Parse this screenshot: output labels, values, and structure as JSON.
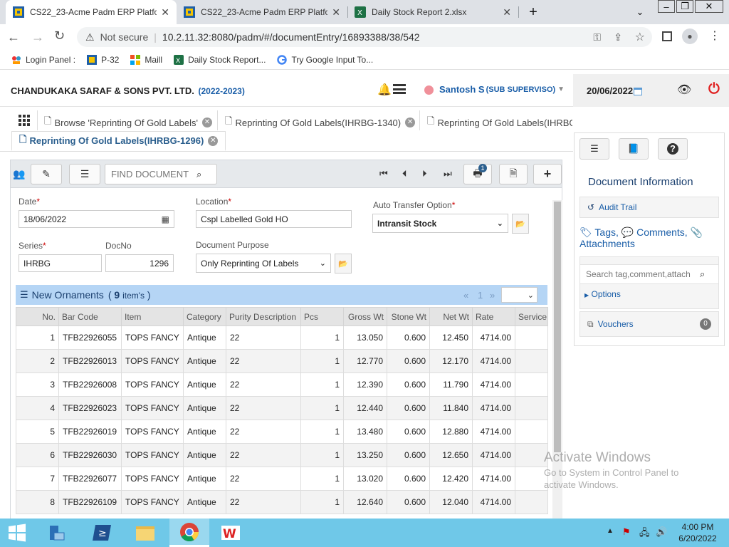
{
  "browser": {
    "tabs": [
      {
        "title": "CS22_23-Acme Padm ERP Platfor",
        "active": true
      },
      {
        "title": "CS22_23-Acme Padm ERP Platfor",
        "active": false
      },
      {
        "title": "Daily Stock Report 2.xlsx",
        "active": false
      }
    ],
    "security": "Not secure",
    "url": "10.2.11.32:8080/padm/#/documentEntry/16893388/38/542",
    "bookmarks": [
      "Login Panel :",
      "P-32",
      "Maill",
      "Daily Stock Report...",
      "Try Google Input To..."
    ]
  },
  "header": {
    "company": "CHANDUKAKA SARAF & SONS PVT. LTD.",
    "fy": "(2022-2023)",
    "user": "Santosh S",
    "role": "(SUB SUPERVISO)",
    "date": "20/06/2022"
  },
  "doc_tabs": [
    {
      "label": "Browse 'Reprinting Of Gold Labels'"
    },
    {
      "label": "Reprinting Of Gold Labels(IHRBG-1340)"
    },
    {
      "label": "Reprinting Of Gold Labels(IHRBG"
    },
    {
      "label": "Reprinting Of Gold Labels(IHRBG-1296)"
    }
  ],
  "toolbar": {
    "find_placeholder": "FIND DOCUMENT",
    "badge": "1"
  },
  "form": {
    "date_label": "Date",
    "date_value": "18/06/2022",
    "location_label": "Location",
    "location_value": "Cspl Labelled Gold HO",
    "auto_transfer_label": "Auto Transfer Option",
    "auto_transfer_value": "Intransit Stock",
    "series_label": "Series",
    "series_value": "IHRBG",
    "docno_label": "DocNo",
    "docno_value": "1296",
    "purpose_label": "Document Purpose",
    "purpose_value": "Only Reprinting Of Labels"
  },
  "grid": {
    "title": "New Ornaments",
    "count": "9",
    "count_suffix": "item's",
    "pager": {
      "prev": "«",
      "page": "1",
      "next": "»"
    },
    "columns": [
      "No.",
      "Bar Code",
      "Item",
      "Category",
      "Purity Description",
      "Pcs",
      "Gross Wt",
      "Stone Wt",
      "Net Wt",
      "Rate",
      "Service"
    ],
    "rows": [
      [
        "1",
        "TFB22926055",
        "TOPS FANCY",
        "Antique",
        "22",
        "1",
        "13.050",
        "0.600",
        "12.450",
        "4714.00",
        ""
      ],
      [
        "2",
        "TFB22926013",
        "TOPS FANCY",
        "Antique",
        "22",
        "1",
        "12.770",
        "0.600",
        "12.170",
        "4714.00",
        ""
      ],
      [
        "3",
        "TFB22926008",
        "TOPS FANCY",
        "Antique",
        "22",
        "1",
        "12.390",
        "0.600",
        "11.790",
        "4714.00",
        ""
      ],
      [
        "4",
        "TFB22926023",
        "TOPS FANCY",
        "Antique",
        "22",
        "1",
        "12.440",
        "0.600",
        "11.840",
        "4714.00",
        ""
      ],
      [
        "5",
        "TFB22926019",
        "TOPS FANCY",
        "Antique",
        "22",
        "1",
        "13.480",
        "0.600",
        "12.880",
        "4714.00",
        ""
      ],
      [
        "6",
        "TFB22926030",
        "TOPS FANCY",
        "Antique",
        "22",
        "1",
        "13.250",
        "0.600",
        "12.650",
        "4714.00",
        ""
      ],
      [
        "7",
        "TFB22926077",
        "TOPS FANCY",
        "Antique",
        "22",
        "1",
        "13.020",
        "0.600",
        "12.420",
        "4714.00",
        ""
      ],
      [
        "8",
        "TFB22926109",
        "TOPS FANCY",
        "Antique",
        "22",
        "1",
        "12.640",
        "0.600",
        "12.040",
        "4714.00",
        ""
      ]
    ]
  },
  "right_panel": {
    "title": "Document Information",
    "audit": "Audit Trail",
    "tags": "Tags,",
    "comments": "Comments,",
    "attachments": "Attachments",
    "search_placeholder": "Search tag,comment,attach",
    "options": "Options",
    "vouchers": "Vouchers",
    "vouchers_count": "0"
  },
  "watermark": {
    "line1": "Activate Windows",
    "line2": "Go to System in Control Panel to",
    "line3": "activate Windows."
  },
  "taskbar": {
    "time": "4:00 PM",
    "date": "6/20/2022"
  },
  "colors": {
    "accent": "#1a5ea8",
    "grid_header": "#b5d5f5",
    "taskbar": "#6fc8e8",
    "power": "#e02020"
  }
}
